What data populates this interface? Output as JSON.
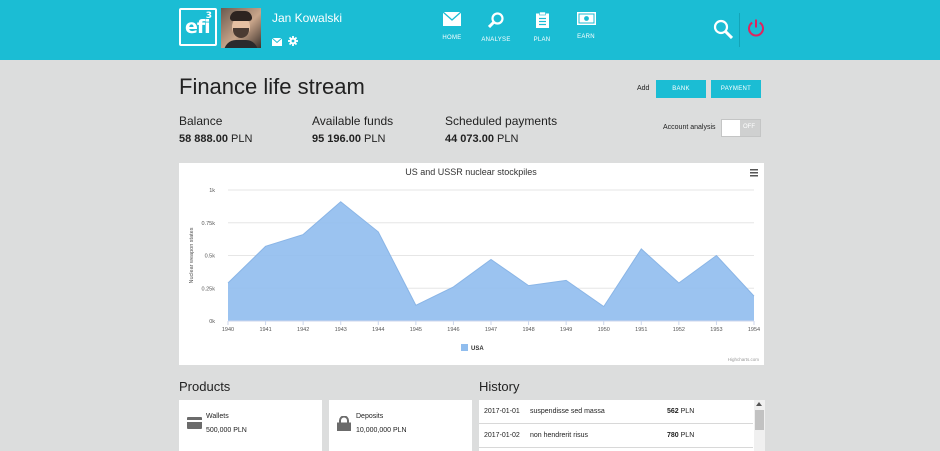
{
  "header": {
    "logo": {
      "text": "efi",
      "superscript": "3"
    },
    "user": {
      "name": "Jan Kowalski",
      "icons": [
        "mail-icon",
        "gear-icon"
      ]
    },
    "nav": [
      {
        "label": "HOME",
        "icon": "mail-icon"
      },
      {
        "label": "ANALYSE",
        "icon": "search-icon"
      },
      {
        "label": "PLAN",
        "icon": "clipboard-icon"
      },
      {
        "label": "EARN",
        "icon": "banknote-icon"
      }
    ],
    "right_icons": [
      "search-icon",
      "power-icon"
    ],
    "colors": {
      "bar": "#1bbdd4",
      "power": "#e0245e"
    }
  },
  "page": {
    "title": "Finance life stream",
    "add_label": "Add",
    "bank_button": "BANK",
    "payment_button": "PAYMENT",
    "account_analysis_label": "Account analysis",
    "toggle_state": "OFF"
  },
  "stats": {
    "balance": {
      "label": "Balance",
      "amount": "58 888.00",
      "currency": "PLN"
    },
    "funds": {
      "label": "Available funds",
      "amount": "95 196.00",
      "currency": "PLN"
    },
    "scheduled": {
      "label": "Scheduled payments",
      "amount": "44 073.00",
      "currency": "PLN"
    }
  },
  "chart_data": {
    "type": "area",
    "title": "US and USSR nuclear stockpiles",
    "ylabel": "Nuclear weapon states",
    "xlabel": "",
    "x": [
      "1940",
      "1941",
      "1942",
      "1943",
      "1944",
      "1945",
      "1946",
      "1947",
      "1948",
      "1949",
      "1950",
      "1951",
      "1952",
      "1953",
      "1954"
    ],
    "y_ticks": [
      "0k",
      "0.25k",
      "0.5k",
      "0.75k",
      "1k"
    ],
    "ylim": [
      0,
      1000
    ],
    "series": [
      {
        "name": "USA",
        "values": [
          290,
          570,
          660,
          910,
          680,
          120,
          260,
          470,
          270,
          310,
          110,
          550,
          290,
          500,
          190
        ],
        "color": "#90bdee"
      }
    ],
    "legend": "bottom-center",
    "grid": true,
    "credits": "Highcharts.com"
  },
  "products": {
    "title": "Products",
    "items": [
      {
        "name": "Wallets",
        "amount": "500,000 PLN",
        "icon": "wallet-icon"
      },
      {
        "name": "Deposits",
        "amount": "10,000,000 PLN",
        "icon": "lock-icon"
      }
    ]
  },
  "history": {
    "title": "History",
    "rows": [
      {
        "date": "2017-01-01",
        "description": "suspendisse sed massa",
        "amount": "562",
        "currency": "PLN"
      },
      {
        "date": "2017-01-02",
        "description": "non hendrerit risus",
        "amount": "780",
        "currency": "PLN"
      }
    ]
  }
}
